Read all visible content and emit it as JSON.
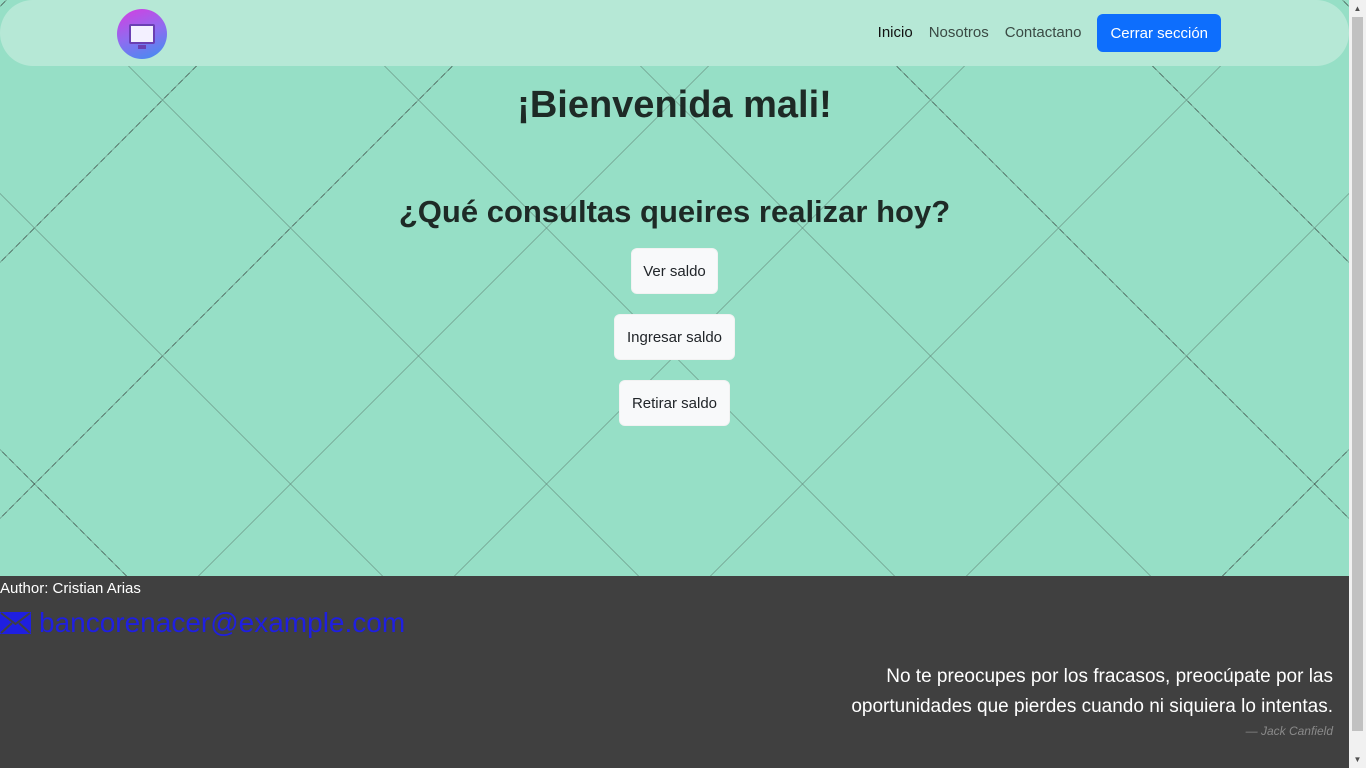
{
  "navbar": {
    "logo_icon": "bank-monitor-logo-icon",
    "links": [
      {
        "label": "Inicio"
      },
      {
        "label": "Nosotros"
      },
      {
        "label": "Contactano"
      }
    ],
    "logout_label": "Cerrar sección",
    "logout_color": "#0d6efd"
  },
  "main": {
    "welcome": "¡Bienvenida mali!",
    "question": "¿Qué consultas queires realizar hoy?",
    "actions": [
      {
        "label": "Ver saldo"
      },
      {
        "label": "Ingresar saldo"
      },
      {
        "label": "Retirar saldo"
      }
    ],
    "background_color": "#96dfc6"
  },
  "footer": {
    "author": "Author: Cristian Arias",
    "email_icon": "mail-icon",
    "email": "bancorenacer@example.com",
    "quote": "No te preocupes por los fracasos, preocúpate por las oportunidades que pierdes cuando ni siquiera lo intentas.",
    "quote_author": "—  Jack Canfield",
    "background_color": "#404040"
  }
}
